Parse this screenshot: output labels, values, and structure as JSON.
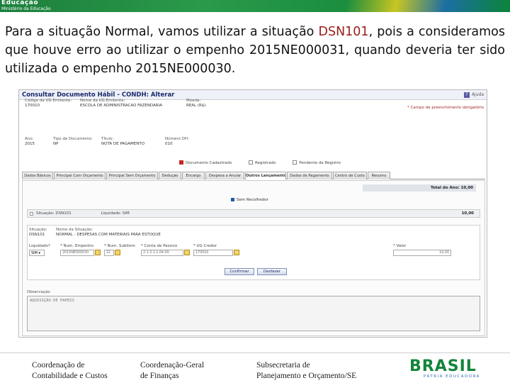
{
  "banner": {
    "logo_line1": "Educação",
    "logo_line2": "Ministério da Educação"
  },
  "headline": {
    "part1": "Para a situação Normal, vamos utilizar a situação ",
    "highlight": "DSN101",
    "part2": ", pois a consideramos que houve erro ao utilizar o empenho 2015NE000031, quando deveria ter sido utilizada o empenho 2015NE000030."
  },
  "screen": {
    "title": "Consultar Documento Hábil - CONDH: Alterar",
    "help_label": "Ajuda",
    "required_note": "* Campo de preenchimento obrigatório",
    "header_fields": {
      "codigo_ug_label": "Código da UG Emitente:",
      "codigo_ug_value": "170010",
      "nome_ug_label": "Nome da UG Emitente:",
      "nome_ug_value": "ESCOLA DE ADMINISTRACAO FAZENDARIA",
      "moeda_label": "Moeda:",
      "moeda_value": "REAL (R$)",
      "ano_label": "Ano:",
      "ano_value": "2015",
      "tipo_label": "Tipo de Documento:",
      "tipo_value": "NP",
      "titulo_label": "Título:",
      "titulo_value": "NOTA DE PAGAMENTO",
      "numero_label": "Número DH:",
      "numero_value": "010"
    },
    "checks": {
      "c1": "Documento Cadastrado",
      "c2": "Registrado",
      "c3": "Pendente de Registro"
    },
    "tabs": [
      "Dados Básicos",
      "Principal Com Orçamento",
      "Principal Sem Orçamento",
      "Dedução",
      "Encargo",
      "Despesa a Anular",
      "Outros Lançamentos",
      "Dados de Pagamento",
      "Centro de Custo",
      "Resumo"
    ],
    "total_label": "Total do Ano: 10,00",
    "sem_recolhedor": "Sem Recolhedor",
    "situacao_bar": "Situação: DSN101",
    "liquidado_label": "Liquidado: SIM",
    "situacao_value": "10,00",
    "inner": {
      "situacao_label": "Situação:",
      "situacao_code": "DSN101",
      "nome_situacao_label": "Nome da Situação:",
      "nome_situacao_value": "NORMAL - DESPESAS COM MATERIAIS PARA ESTOQUE",
      "liquidado_label": "Liquidado?",
      "liquidado_value": "SIM",
      "empenho_label": "* Num. Empenho",
      "empenho_value": "2015NE000030",
      "subitem_label": "* Num. Subitem",
      "subitem_value": "22",
      "conta_label": "* Conta de Passivo",
      "conta_value": "2.1.3.1.1.04.00",
      "ug_label": "* UG Credor",
      "ug_value": "170010",
      "valor_label": "* Valor",
      "valor_value": "10,00",
      "confirmar": "Confirmar",
      "desfazer": "Desfazer"
    },
    "observacao_label": "Observação",
    "observacao_value": "AQUISIÇÃO DE PAPEIS"
  },
  "footer": {
    "f1_line1": "Coordenação de",
    "f1_line2": "Contabilidade e Custos",
    "f2_line1": "Coordenação-Geral",
    "f2_line2": "de Finanças",
    "f3_line1": "Subsecretaria de",
    "f3_line2": "Planejamento e Orçamento/SE",
    "brand": "BRASIL",
    "brand_tag": "PÁTRIA EDUCADORA"
  }
}
